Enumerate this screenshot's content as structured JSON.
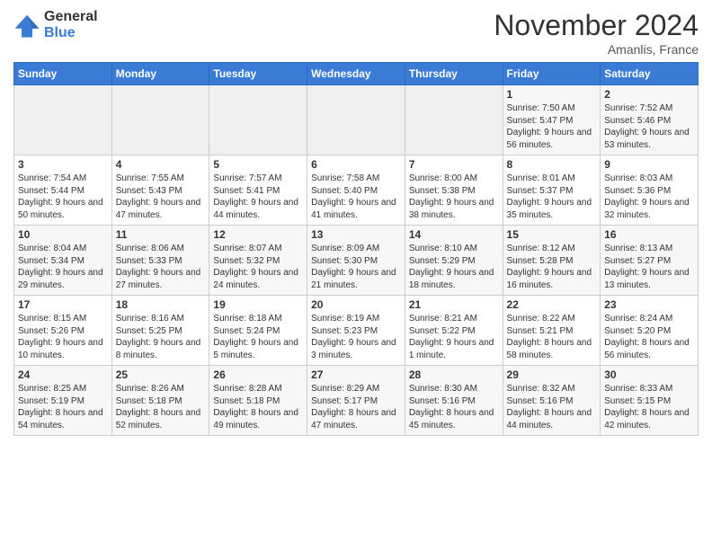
{
  "header": {
    "logo_general": "General",
    "logo_blue": "Blue",
    "title": "November 2024",
    "location": "Amanlis, France"
  },
  "days_of_week": [
    "Sunday",
    "Monday",
    "Tuesday",
    "Wednesday",
    "Thursday",
    "Friday",
    "Saturday"
  ],
  "weeks": [
    [
      {
        "day": "",
        "detail": ""
      },
      {
        "day": "",
        "detail": ""
      },
      {
        "day": "",
        "detail": ""
      },
      {
        "day": "",
        "detail": ""
      },
      {
        "day": "",
        "detail": ""
      },
      {
        "day": "1",
        "detail": "Sunrise: 7:50 AM\nSunset: 5:47 PM\nDaylight: 9 hours and 56 minutes."
      },
      {
        "day": "2",
        "detail": "Sunrise: 7:52 AM\nSunset: 5:46 PM\nDaylight: 9 hours and 53 minutes."
      }
    ],
    [
      {
        "day": "3",
        "detail": "Sunrise: 7:54 AM\nSunset: 5:44 PM\nDaylight: 9 hours and 50 minutes."
      },
      {
        "day": "4",
        "detail": "Sunrise: 7:55 AM\nSunset: 5:43 PM\nDaylight: 9 hours and 47 minutes."
      },
      {
        "day": "5",
        "detail": "Sunrise: 7:57 AM\nSunset: 5:41 PM\nDaylight: 9 hours and 44 minutes."
      },
      {
        "day": "6",
        "detail": "Sunrise: 7:58 AM\nSunset: 5:40 PM\nDaylight: 9 hours and 41 minutes."
      },
      {
        "day": "7",
        "detail": "Sunrise: 8:00 AM\nSunset: 5:38 PM\nDaylight: 9 hours and 38 minutes."
      },
      {
        "day": "8",
        "detail": "Sunrise: 8:01 AM\nSunset: 5:37 PM\nDaylight: 9 hours and 35 minutes."
      },
      {
        "day": "9",
        "detail": "Sunrise: 8:03 AM\nSunset: 5:36 PM\nDaylight: 9 hours and 32 minutes."
      }
    ],
    [
      {
        "day": "10",
        "detail": "Sunrise: 8:04 AM\nSunset: 5:34 PM\nDaylight: 9 hours and 29 minutes."
      },
      {
        "day": "11",
        "detail": "Sunrise: 8:06 AM\nSunset: 5:33 PM\nDaylight: 9 hours and 27 minutes."
      },
      {
        "day": "12",
        "detail": "Sunrise: 8:07 AM\nSunset: 5:32 PM\nDaylight: 9 hours and 24 minutes."
      },
      {
        "day": "13",
        "detail": "Sunrise: 8:09 AM\nSunset: 5:30 PM\nDaylight: 9 hours and 21 minutes."
      },
      {
        "day": "14",
        "detail": "Sunrise: 8:10 AM\nSunset: 5:29 PM\nDaylight: 9 hours and 18 minutes."
      },
      {
        "day": "15",
        "detail": "Sunrise: 8:12 AM\nSunset: 5:28 PM\nDaylight: 9 hours and 16 minutes."
      },
      {
        "day": "16",
        "detail": "Sunrise: 8:13 AM\nSunset: 5:27 PM\nDaylight: 9 hours and 13 minutes."
      }
    ],
    [
      {
        "day": "17",
        "detail": "Sunrise: 8:15 AM\nSunset: 5:26 PM\nDaylight: 9 hours and 10 minutes."
      },
      {
        "day": "18",
        "detail": "Sunrise: 8:16 AM\nSunset: 5:25 PM\nDaylight: 9 hours and 8 minutes."
      },
      {
        "day": "19",
        "detail": "Sunrise: 8:18 AM\nSunset: 5:24 PM\nDaylight: 9 hours and 5 minutes."
      },
      {
        "day": "20",
        "detail": "Sunrise: 8:19 AM\nSunset: 5:23 PM\nDaylight: 9 hours and 3 minutes."
      },
      {
        "day": "21",
        "detail": "Sunrise: 8:21 AM\nSunset: 5:22 PM\nDaylight: 9 hours and 1 minute."
      },
      {
        "day": "22",
        "detail": "Sunrise: 8:22 AM\nSunset: 5:21 PM\nDaylight: 8 hours and 58 minutes."
      },
      {
        "day": "23",
        "detail": "Sunrise: 8:24 AM\nSunset: 5:20 PM\nDaylight: 8 hours and 56 minutes."
      }
    ],
    [
      {
        "day": "24",
        "detail": "Sunrise: 8:25 AM\nSunset: 5:19 PM\nDaylight: 8 hours and 54 minutes."
      },
      {
        "day": "25",
        "detail": "Sunrise: 8:26 AM\nSunset: 5:18 PM\nDaylight: 8 hours and 52 minutes."
      },
      {
        "day": "26",
        "detail": "Sunrise: 8:28 AM\nSunset: 5:18 PM\nDaylight: 8 hours and 49 minutes."
      },
      {
        "day": "27",
        "detail": "Sunrise: 8:29 AM\nSunset: 5:17 PM\nDaylight: 8 hours and 47 minutes."
      },
      {
        "day": "28",
        "detail": "Sunrise: 8:30 AM\nSunset: 5:16 PM\nDaylight: 8 hours and 45 minutes."
      },
      {
        "day": "29",
        "detail": "Sunrise: 8:32 AM\nSunset: 5:16 PM\nDaylight: 8 hours and 44 minutes."
      },
      {
        "day": "30",
        "detail": "Sunrise: 8:33 AM\nSunset: 5:15 PM\nDaylight: 8 hours and 42 minutes."
      }
    ]
  ]
}
